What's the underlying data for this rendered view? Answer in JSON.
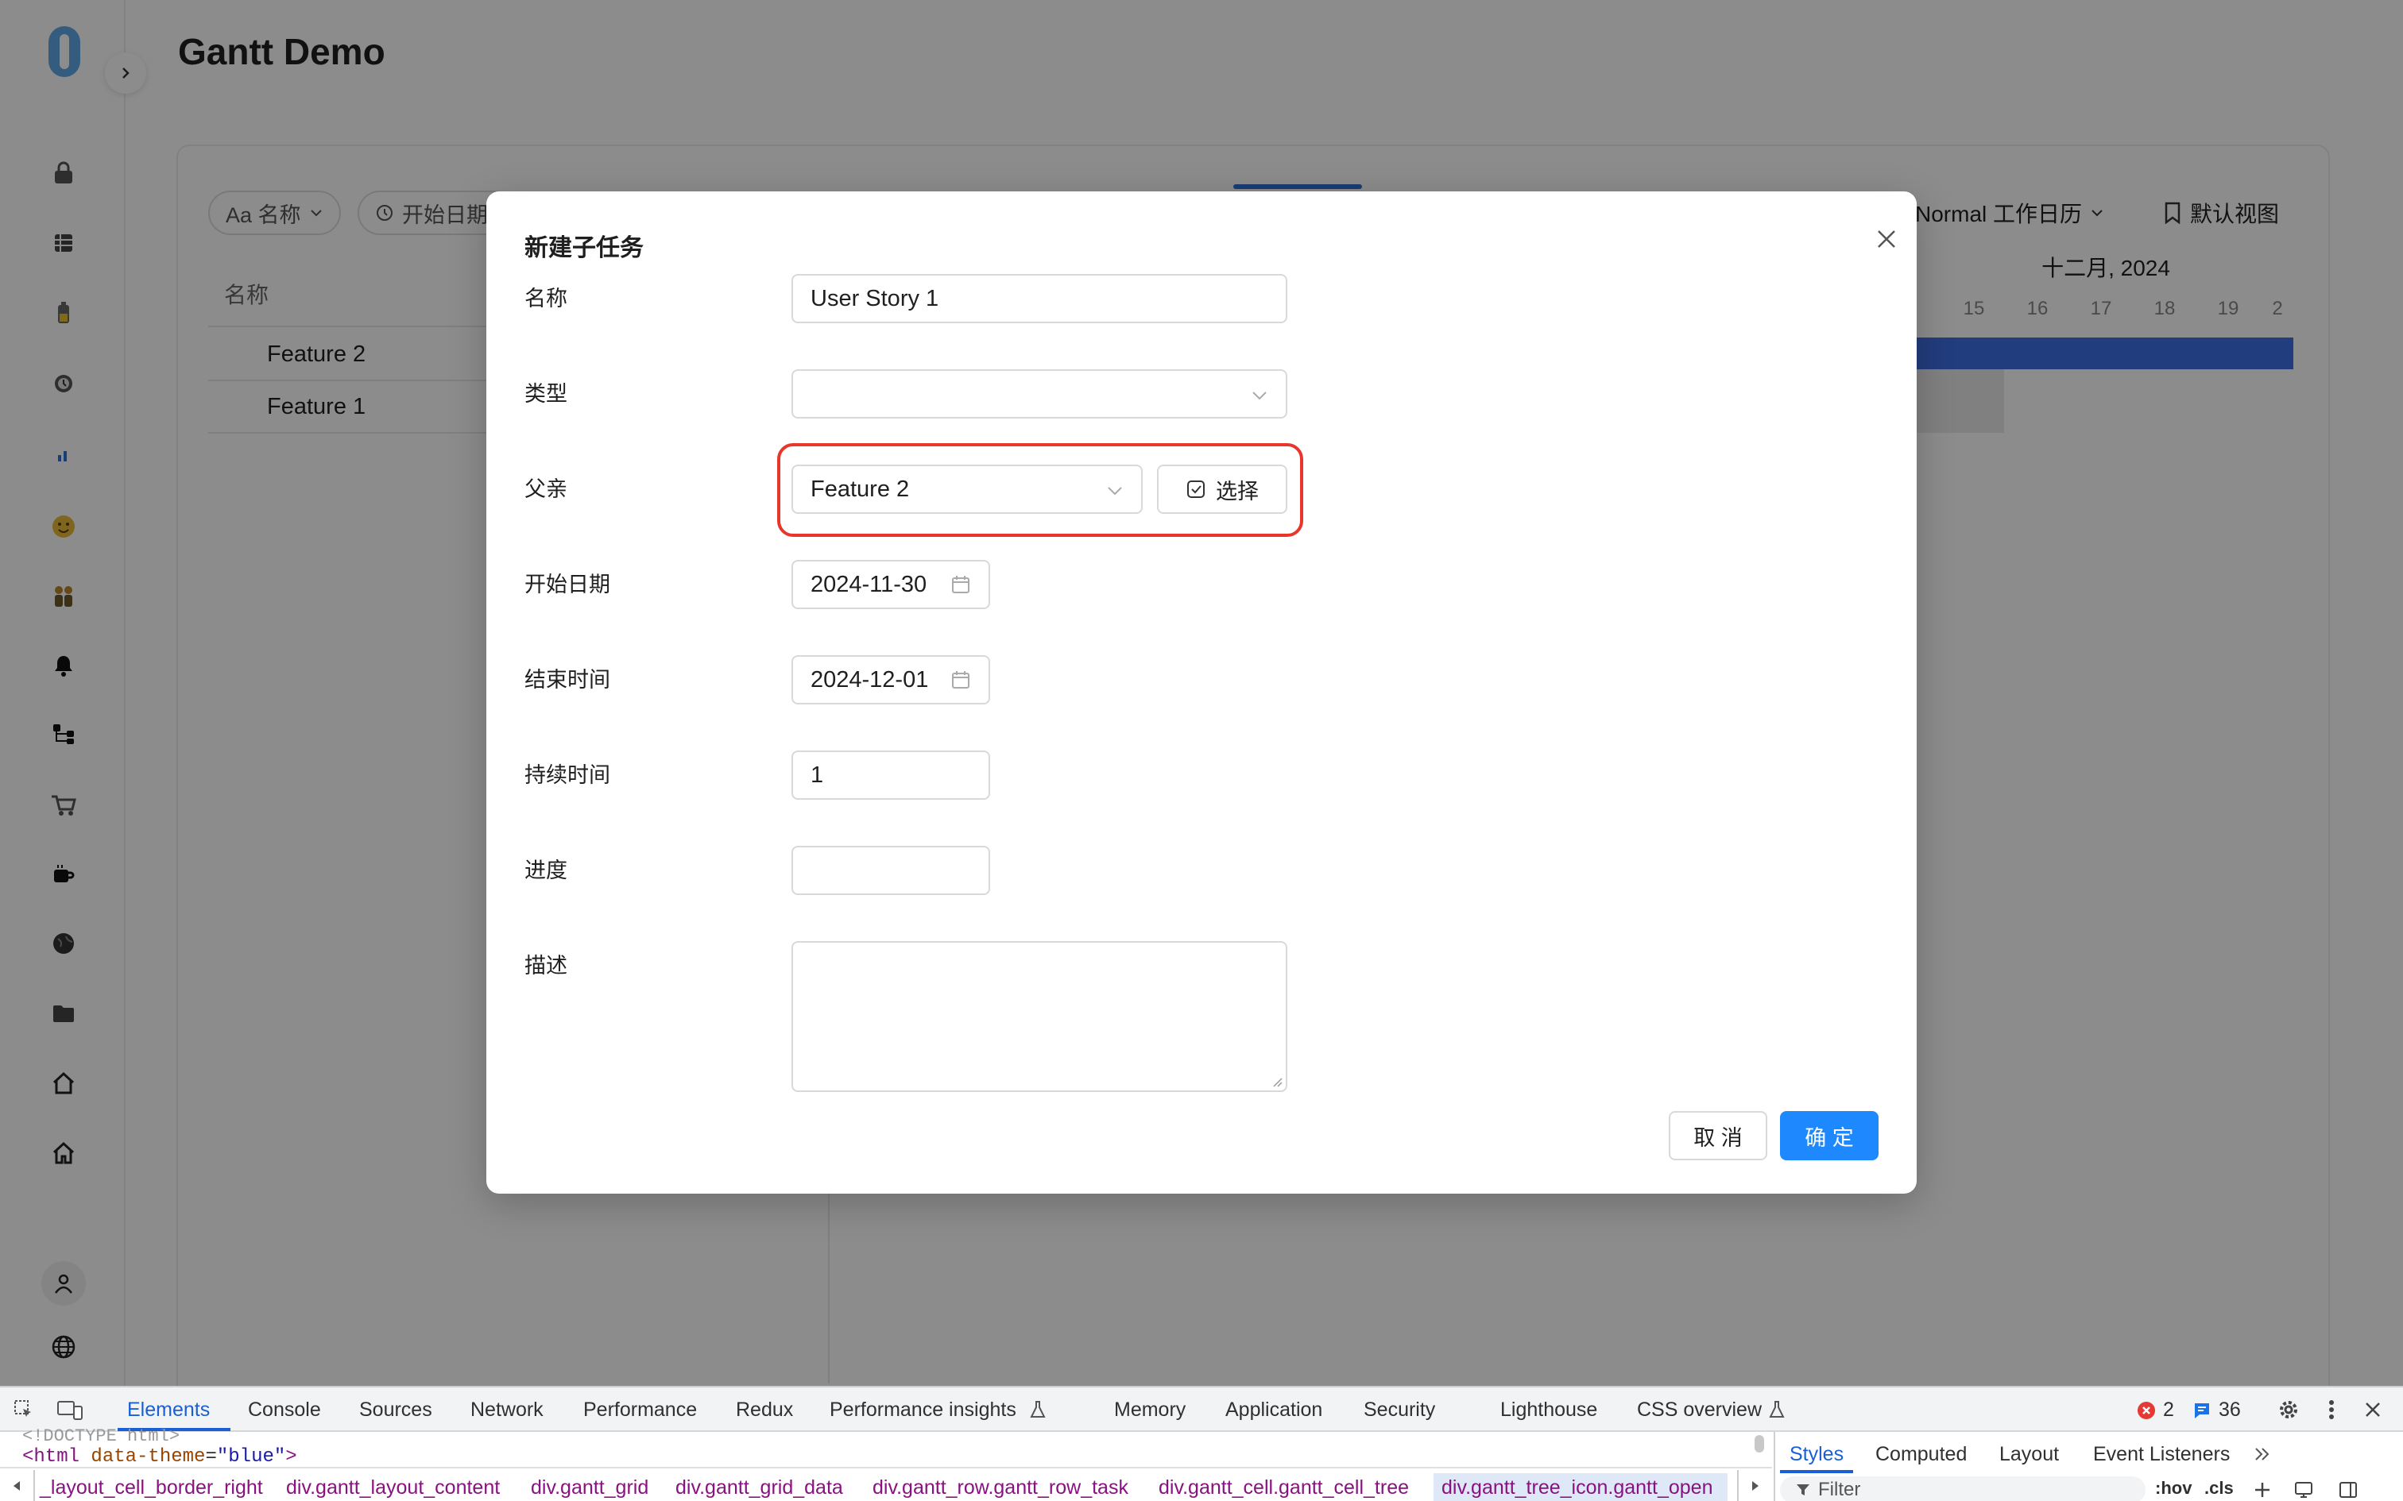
{
  "page": {
    "title": "Gantt Demo"
  },
  "toolbar": {
    "name_chip": "Aa 名称",
    "start_chip": "开始日期",
    "calendar": "Normal 工作日历",
    "view": "默认视图"
  },
  "grid": {
    "header": "名称",
    "rows": [
      "Feature 2",
      "Feature 1"
    ]
  },
  "timeline": {
    "month": "十二月, 2024",
    "days": [
      "15",
      "16",
      "17",
      "18",
      "19",
      "2"
    ]
  },
  "modal": {
    "title": "新建子任务",
    "fields": {
      "name": {
        "label": "名称",
        "value": "User Story 1"
      },
      "type": {
        "label": "类型",
        "value": ""
      },
      "parent": {
        "label": "父亲",
        "value": "Feature 2",
        "select_button": "选择"
      },
      "start": {
        "label": "开始日期",
        "value": "2024-11-30"
      },
      "end": {
        "label": "结束时间",
        "value": "2024-12-01"
      },
      "duration": {
        "label": "持续时间",
        "value": "1"
      },
      "progress": {
        "label": "进度",
        "value": ""
      },
      "description": {
        "label": "描述",
        "value": ""
      }
    },
    "cancel": "取 消",
    "ok": "确 定",
    "highlight_color": "#e8362c",
    "primary_color": "#1e88ff"
  },
  "devtools": {
    "tabs": [
      "Elements",
      "Console",
      "Sources",
      "Network",
      "Performance",
      "Redux",
      "Performance insights",
      "Memory",
      "Application",
      "Security",
      "Lighthouse",
      "CSS overview"
    ],
    "error_count": "2",
    "message_count": "36",
    "html_line_tag": "<html",
    "html_line_attr": "data-theme",
    "html_line_value": "\"blue\"",
    "breadcrumbs": [
      "_layout_cell_border_right",
      "div.gantt_layout_content",
      "div.gantt_grid",
      "div.gantt_grid_data",
      "div.gantt_row.gantt_row_task",
      "div.gantt_cell.gantt_cell_tree",
      "div.gantt_tree_icon.gantt_open"
    ],
    "side_tabs": [
      "Styles",
      "Computed",
      "Layout",
      "Event Listeners"
    ],
    "filter_placeholder": "Filter",
    "hov": ":hov",
    "cls": ".cls"
  }
}
